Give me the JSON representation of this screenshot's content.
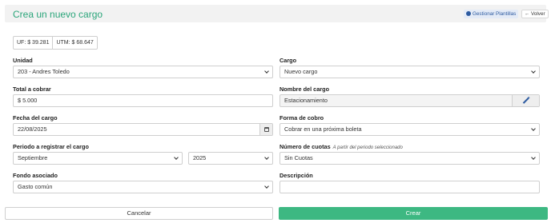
{
  "header": {
    "title": "Crea un nuevo cargo",
    "templates_button": "Gestionar Plantillas",
    "back_button": "← Volver"
  },
  "indicators": {
    "uf": "UF: $ 39.281",
    "utm": "UTM: $ 68.647"
  },
  "form": {
    "unidad": {
      "label": "Unidad",
      "value": "203 - Andres Toledo"
    },
    "cargo": {
      "label": "Cargo",
      "value": "Nuevo cargo"
    },
    "total": {
      "label": "Total a cobrar",
      "value": "$ 5.000"
    },
    "nombre": {
      "label": "Nombre del cargo",
      "value": "Estacionamiento"
    },
    "fecha": {
      "label": "Fecha del cargo",
      "value": "22/08/2025"
    },
    "forma": {
      "label": "Forma de cobro",
      "value": "Cobrar en una próxima boleta"
    },
    "periodo": {
      "label": "Periodo a registrar el cargo",
      "month": "Septiembre",
      "year": "2025"
    },
    "cuotas": {
      "label": "Número de cuotas",
      "hint": "A partir del periodo seleccionado",
      "value": "Sin Cuotas"
    },
    "fondo": {
      "label": "Fondo asociado",
      "value": "Gasto común"
    },
    "descripcion": {
      "label": "Descripción",
      "value": ""
    }
  },
  "actions": {
    "cancel": "Cancelar",
    "create": "Crear"
  },
  "icons": {
    "templates": "gear-icon",
    "calendar": "calendar-icon",
    "magic": "magic-wand-icon",
    "dropdown": "chevron-down-icon"
  },
  "colors": {
    "title": "#2aa57a",
    "create_button": "#3db882",
    "templates_button_bg": "#e4ebf7",
    "templates_button_text": "#2c5aa0"
  }
}
